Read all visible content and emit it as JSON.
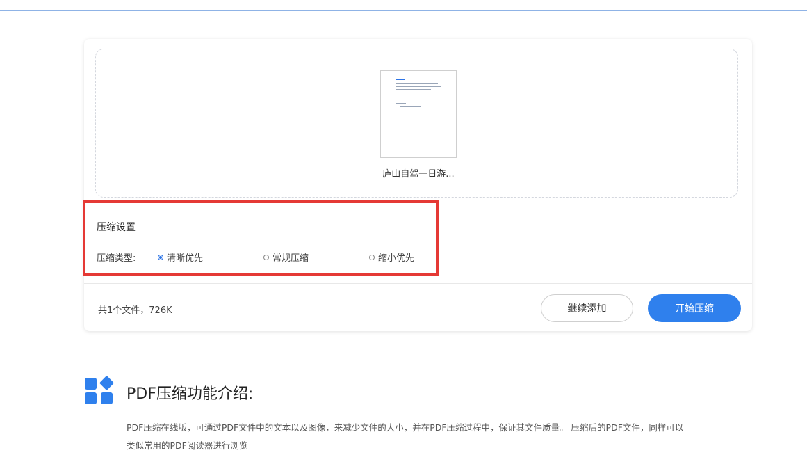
{
  "upload": {
    "file_name": "庐山自驾一日游..."
  },
  "settings": {
    "title": "压缩设置",
    "type_label": "压缩类型:",
    "options": [
      {
        "label": "清晰优先",
        "checked": true
      },
      {
        "label": "常规压缩",
        "checked": false
      },
      {
        "label": "缩小优先",
        "checked": false
      }
    ]
  },
  "footer": {
    "summary": "共1个文件，726K",
    "continue_label": "继续添加",
    "start_label": "开始压缩"
  },
  "intro": {
    "title": "PDF压缩功能介绍:",
    "text": "PDF压缩在线版，可通过PDF文件中的文本以及图像，来减少文件的大小，并在PDF压缩过程中，保证其文件质量。 压缩后的PDF文件，同样可以",
    "text_line2": "类似常用的PDF阅读器进行浏览"
  },
  "colors": {
    "accent": "#2f80ed",
    "highlight": "#e53935"
  }
}
